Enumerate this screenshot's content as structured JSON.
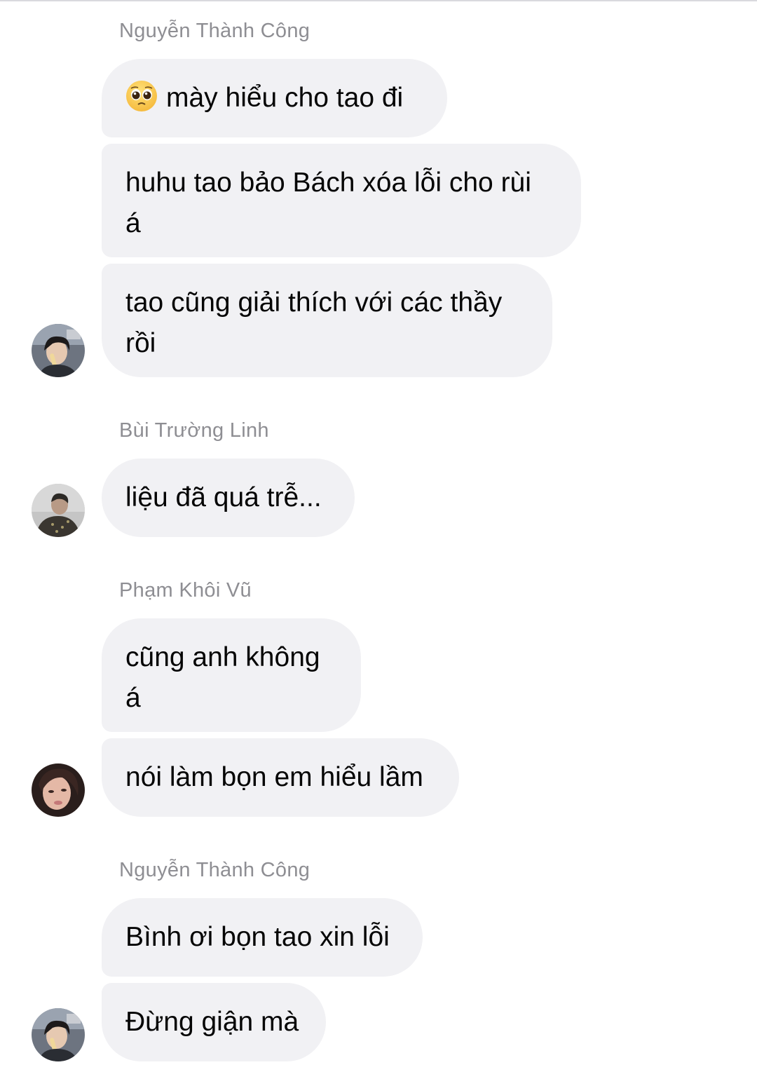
{
  "groups": [
    {
      "sender": "Nguyễn Thành Công",
      "messages": [
        {
          "emoji": "pleading-face-emoji",
          "text": "mày hiểu cho tao đi"
        },
        {
          "line1": "huhu tao bảo Bách xóa lỗi cho rùi",
          "line2": "á"
        },
        {
          "line1": "tao cũng giải thích với các thầy",
          "line2": "rồi"
        }
      ]
    },
    {
      "sender": "Bùi Trường Linh",
      "messages": [
        {
          "text": "liệu đã quá trễ..."
        }
      ]
    },
    {
      "sender": "Phạm Khôi Vũ",
      "messages": [
        {
          "line1": "cũng anh không",
          "line2": "á"
        },
        {
          "text": "nói làm bọn em hiểu lầm"
        }
      ]
    },
    {
      "sender": "Nguyễn Thành Công",
      "messages": [
        {
          "text": "Bình ơi bọn tao xin lỗi"
        },
        {
          "text": "Đừng giận mà"
        }
      ]
    }
  ],
  "colors": {
    "bubble": "#f1f1f4",
    "sender_text": "#8e8e93",
    "message_text": "#050505"
  }
}
